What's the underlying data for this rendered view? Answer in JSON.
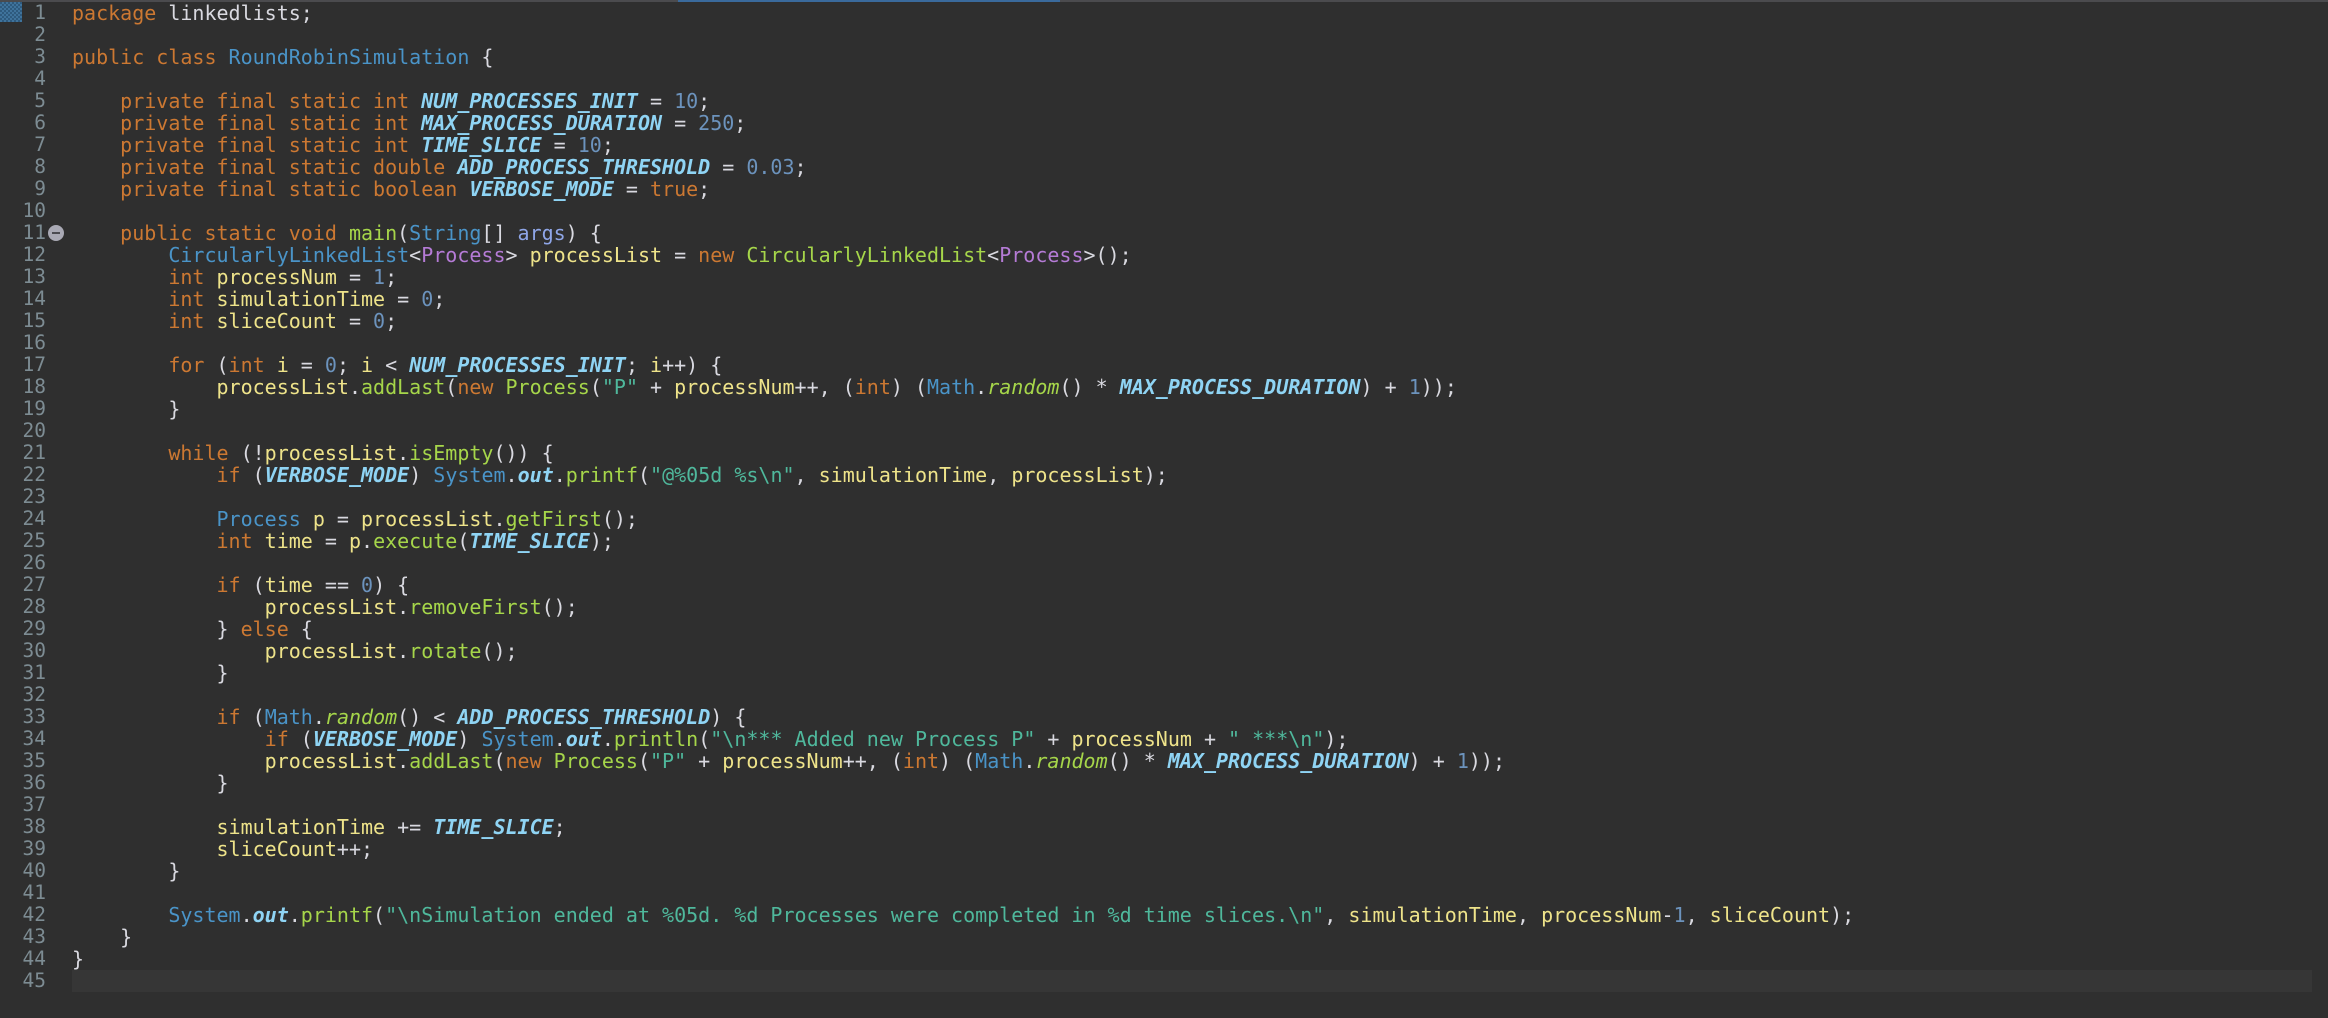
{
  "editor": {
    "language": "java",
    "current_line": 45,
    "folded_marker_line": 11,
    "lines": [
      [
        [
          "kw",
          "package"
        ],
        [
          "pl",
          " linkedlists;"
        ]
      ],
      [],
      [
        [
          "kw",
          "public class "
        ],
        [
          "cls",
          "RoundRobinSimulation"
        ],
        [
          "pl",
          " {"
        ]
      ],
      [],
      [
        [
          "pl",
          "    "
        ],
        [
          "kw",
          "private final static int "
        ],
        [
          "cst",
          "NUM_PROCESSES_INIT"
        ],
        [
          "pl",
          " = "
        ],
        [
          "num",
          "10"
        ],
        [
          "pl",
          ";"
        ]
      ],
      [
        [
          "pl",
          "    "
        ],
        [
          "kw",
          "private final static int "
        ],
        [
          "cst",
          "MAX_PROCESS_DURATION"
        ],
        [
          "pl",
          " = "
        ],
        [
          "num",
          "250"
        ],
        [
          "pl",
          ";"
        ]
      ],
      [
        [
          "pl",
          "    "
        ],
        [
          "kw",
          "private final static int "
        ],
        [
          "cst",
          "TIME_SLICE"
        ],
        [
          "pl",
          " = "
        ],
        [
          "num",
          "10"
        ],
        [
          "pl",
          ";"
        ]
      ],
      [
        [
          "pl",
          "    "
        ],
        [
          "kw",
          "private final static double "
        ],
        [
          "cst",
          "ADD_PROCESS_THRESHOLD"
        ],
        [
          "pl",
          " = "
        ],
        [
          "num",
          "0.03"
        ],
        [
          "pl",
          ";"
        ]
      ],
      [
        [
          "pl",
          "    "
        ],
        [
          "kw",
          "private final static boolean "
        ],
        [
          "cst",
          "VERBOSE_MODE"
        ],
        [
          "pl",
          " = "
        ],
        [
          "kw",
          "true"
        ],
        [
          "pl",
          ";"
        ]
      ],
      [],
      [
        [
          "pl",
          "    "
        ],
        [
          "kw",
          "public static void "
        ],
        [
          "fn",
          "main"
        ],
        [
          "pl",
          "("
        ],
        [
          "cls",
          "String"
        ],
        [
          "pl",
          "[] "
        ],
        [
          "prm",
          "args"
        ],
        [
          "pl",
          ") {"
        ]
      ],
      [
        [
          "pl",
          "        "
        ],
        [
          "cls",
          "CircularlyLinkedList"
        ],
        [
          "pl",
          "<"
        ],
        [
          "tp",
          "Process"
        ],
        [
          "pl",
          "> "
        ],
        [
          "var",
          "processList"
        ],
        [
          "pl",
          " = "
        ],
        [
          "kw",
          "new "
        ],
        [
          "fn",
          "CircularlyLinkedList"
        ],
        [
          "pl",
          "<"
        ],
        [
          "tp",
          "Process"
        ],
        [
          "pl",
          ">();"
        ]
      ],
      [
        [
          "pl",
          "        "
        ],
        [
          "kw",
          "int "
        ],
        [
          "var",
          "processNum"
        ],
        [
          "pl",
          " = "
        ],
        [
          "num",
          "1"
        ],
        [
          "pl",
          ";"
        ]
      ],
      [
        [
          "pl",
          "        "
        ],
        [
          "kw",
          "int "
        ],
        [
          "var",
          "simulationTime"
        ],
        [
          "pl",
          " = "
        ],
        [
          "num",
          "0"
        ],
        [
          "pl",
          ";"
        ]
      ],
      [
        [
          "pl",
          "        "
        ],
        [
          "kw",
          "int "
        ],
        [
          "var",
          "sliceCount"
        ],
        [
          "pl",
          " = "
        ],
        [
          "num",
          "0"
        ],
        [
          "pl",
          ";"
        ]
      ],
      [],
      [
        [
          "pl",
          "        "
        ],
        [
          "kw",
          "for"
        ],
        [
          "pl",
          " ("
        ],
        [
          "kw",
          "int "
        ],
        [
          "var",
          "i"
        ],
        [
          "pl",
          " = "
        ],
        [
          "num",
          "0"
        ],
        [
          "pl",
          "; "
        ],
        [
          "var",
          "i"
        ],
        [
          "pl",
          " < "
        ],
        [
          "cst",
          "NUM_PROCESSES_INIT"
        ],
        [
          "pl",
          "; "
        ],
        [
          "var",
          "i"
        ],
        [
          "pl",
          "++) {"
        ]
      ],
      [
        [
          "pl",
          "            "
        ],
        [
          "var",
          "processList"
        ],
        [
          "pl",
          "."
        ],
        [
          "fn",
          "addLast"
        ],
        [
          "pl",
          "("
        ],
        [
          "kw",
          "new "
        ],
        [
          "fn",
          "Process"
        ],
        [
          "pl",
          "("
        ],
        [
          "str",
          "\"P\""
        ],
        [
          "pl",
          " + "
        ],
        [
          "var",
          "processNum"
        ],
        [
          "pl",
          "++, ("
        ],
        [
          "kw",
          "int"
        ],
        [
          "pl",
          ") ("
        ],
        [
          "cls",
          "Math"
        ],
        [
          "pl",
          "."
        ],
        [
          "sfn",
          "random"
        ],
        [
          "pl",
          "() * "
        ],
        [
          "cst",
          "MAX_PROCESS_DURATION"
        ],
        [
          "pl",
          ") + "
        ],
        [
          "num",
          "1"
        ],
        [
          "pl",
          "));"
        ]
      ],
      [
        [
          "pl",
          "        }"
        ]
      ],
      [],
      [
        [
          "pl",
          "        "
        ],
        [
          "kw",
          "while"
        ],
        [
          "pl",
          " (!"
        ],
        [
          "var",
          "processList"
        ],
        [
          "pl",
          "."
        ],
        [
          "fn",
          "isEmpty"
        ],
        [
          "pl",
          "()) {"
        ]
      ],
      [
        [
          "pl",
          "            "
        ],
        [
          "kw",
          "if"
        ],
        [
          "pl",
          " ("
        ],
        [
          "cst",
          "VERBOSE_MODE"
        ],
        [
          "pl",
          ") "
        ],
        [
          "cls",
          "System"
        ],
        [
          "pl",
          "."
        ],
        [
          "cst",
          "out"
        ],
        [
          "pl",
          "."
        ],
        [
          "fn",
          "printf"
        ],
        [
          "pl",
          "("
        ],
        [
          "str",
          "\"@%05d %s\\n\""
        ],
        [
          "pl",
          ", "
        ],
        [
          "var",
          "simulationTime"
        ],
        [
          "pl",
          ", "
        ],
        [
          "var",
          "processList"
        ],
        [
          "pl",
          ");"
        ]
      ],
      [],
      [
        [
          "pl",
          "            "
        ],
        [
          "cls",
          "Process"
        ],
        [
          "pl",
          " "
        ],
        [
          "var",
          "p"
        ],
        [
          "pl",
          " = "
        ],
        [
          "var",
          "processList"
        ],
        [
          "pl",
          "."
        ],
        [
          "fn",
          "getFirst"
        ],
        [
          "pl",
          "();"
        ]
      ],
      [
        [
          "pl",
          "            "
        ],
        [
          "kw",
          "int "
        ],
        [
          "var",
          "time"
        ],
        [
          "pl",
          " = "
        ],
        [
          "var",
          "p"
        ],
        [
          "pl",
          "."
        ],
        [
          "fn",
          "execute"
        ],
        [
          "pl",
          "("
        ],
        [
          "cst",
          "TIME_SLICE"
        ],
        [
          "pl",
          ");"
        ]
      ],
      [],
      [
        [
          "pl",
          "            "
        ],
        [
          "kw",
          "if"
        ],
        [
          "pl",
          " ("
        ],
        [
          "var",
          "time"
        ],
        [
          "pl",
          " == "
        ],
        [
          "num",
          "0"
        ],
        [
          "pl",
          ") {"
        ]
      ],
      [
        [
          "pl",
          "                "
        ],
        [
          "var",
          "processList"
        ],
        [
          "pl",
          "."
        ],
        [
          "fn",
          "removeFirst"
        ],
        [
          "pl",
          "();"
        ]
      ],
      [
        [
          "pl",
          "            } "
        ],
        [
          "kw",
          "else"
        ],
        [
          "pl",
          " {"
        ]
      ],
      [
        [
          "pl",
          "                "
        ],
        [
          "var",
          "processList"
        ],
        [
          "pl",
          "."
        ],
        [
          "fn",
          "rotate"
        ],
        [
          "pl",
          "();"
        ]
      ],
      [
        [
          "pl",
          "            }"
        ]
      ],
      [],
      [
        [
          "pl",
          "            "
        ],
        [
          "kw",
          "if"
        ],
        [
          "pl",
          " ("
        ],
        [
          "cls",
          "Math"
        ],
        [
          "pl",
          "."
        ],
        [
          "sfn",
          "random"
        ],
        [
          "pl",
          "() < "
        ],
        [
          "cst",
          "ADD_PROCESS_THRESHOLD"
        ],
        [
          "pl",
          ") {"
        ]
      ],
      [
        [
          "pl",
          "                "
        ],
        [
          "kw",
          "if"
        ],
        [
          "pl",
          " ("
        ],
        [
          "cst",
          "VERBOSE_MODE"
        ],
        [
          "pl",
          ") "
        ],
        [
          "cls",
          "System"
        ],
        [
          "pl",
          "."
        ],
        [
          "cst",
          "out"
        ],
        [
          "pl",
          "."
        ],
        [
          "fn",
          "println"
        ],
        [
          "pl",
          "("
        ],
        [
          "str",
          "\"\\n*** Added new Process P\""
        ],
        [
          "pl",
          " + "
        ],
        [
          "var",
          "processNum"
        ],
        [
          "pl",
          " + "
        ],
        [
          "str",
          "\" ***\\n\""
        ],
        [
          "pl",
          ");"
        ]
      ],
      [
        [
          "pl",
          "                "
        ],
        [
          "var",
          "processList"
        ],
        [
          "pl",
          "."
        ],
        [
          "fn",
          "addLast"
        ],
        [
          "pl",
          "("
        ],
        [
          "kw",
          "new "
        ],
        [
          "fn",
          "Process"
        ],
        [
          "pl",
          "("
        ],
        [
          "str",
          "\"P\""
        ],
        [
          "pl",
          " + "
        ],
        [
          "var",
          "processNum"
        ],
        [
          "pl",
          "++, ("
        ],
        [
          "kw",
          "int"
        ],
        [
          "pl",
          ") ("
        ],
        [
          "cls",
          "Math"
        ],
        [
          "pl",
          "."
        ],
        [
          "sfn",
          "random"
        ],
        [
          "pl",
          "() * "
        ],
        [
          "cst",
          "MAX_PROCESS_DURATION"
        ],
        [
          "pl",
          ") + "
        ],
        [
          "num",
          "1"
        ],
        [
          "pl",
          "));"
        ]
      ],
      [
        [
          "pl",
          "            }"
        ]
      ],
      [],
      [
        [
          "pl",
          "            "
        ],
        [
          "var",
          "simulationTime"
        ],
        [
          "pl",
          " += "
        ],
        [
          "cst",
          "TIME_SLICE"
        ],
        [
          "pl",
          ";"
        ]
      ],
      [
        [
          "pl",
          "            "
        ],
        [
          "var",
          "sliceCount"
        ],
        [
          "pl",
          "++;"
        ]
      ],
      [
        [
          "pl",
          "        }"
        ]
      ],
      [],
      [
        [
          "pl",
          "        "
        ],
        [
          "cls",
          "System"
        ],
        [
          "pl",
          "."
        ],
        [
          "cst",
          "out"
        ],
        [
          "pl",
          "."
        ],
        [
          "fn",
          "printf"
        ],
        [
          "pl",
          "("
        ],
        [
          "str",
          "\"\\nSimulation ended at %05d. %d Processes were completed in %d time slices.\\n\""
        ],
        [
          "pl",
          ", "
        ],
        [
          "var",
          "simulationTime"
        ],
        [
          "pl",
          ", "
        ],
        [
          "var",
          "processNum"
        ],
        [
          "pl",
          "-"
        ],
        [
          "num",
          "1"
        ],
        [
          "pl",
          ", "
        ],
        [
          "var",
          "sliceCount"
        ],
        [
          "pl",
          ");"
        ]
      ],
      [
        [
          "pl",
          "    }"
        ]
      ],
      [
        [
          "pl",
          "}"
        ]
      ],
      []
    ]
  },
  "icons": {
    "top_marker": "bookmark-marker-icon",
    "fold": "collapse-fold-icon"
  }
}
